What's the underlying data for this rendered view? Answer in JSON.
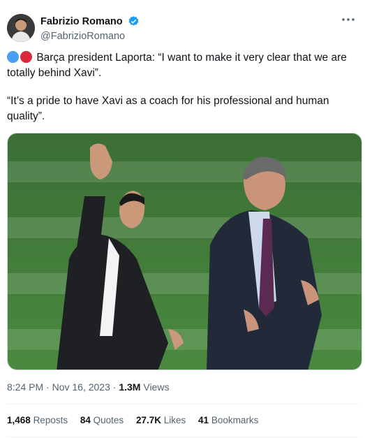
{
  "author": {
    "name": "Fabrizio Romano",
    "handle": "@FabrizioRomano"
  },
  "tweet": {
    "line1": "Barça president Laporta: “I want to make it very clear that we are totally behind Xavi”.",
    "line2": "“It’s a pride to have Xavi as a coach for his professional and human quality”."
  },
  "meta": {
    "time": "8:24 PM",
    "date": "Nov 16, 2023",
    "views_count": "1.3M",
    "views_label": "Views"
  },
  "stats": {
    "reposts_count": "1,468",
    "reposts_label": "Reposts",
    "quotes_count": "84",
    "quotes_label": "Quotes",
    "likes_count": "27.7K",
    "likes_label": "Likes",
    "bookmarks_count": "41",
    "bookmarks_label": "Bookmarks"
  },
  "colors": {
    "blue_dot": "#4a9ff5",
    "red_dot": "#d9283b",
    "verified": "#1d9bf0",
    "pitch": "#3f7a3a"
  },
  "icons": {
    "verified": "verified-badge-icon",
    "more": "more-dots-icon"
  }
}
